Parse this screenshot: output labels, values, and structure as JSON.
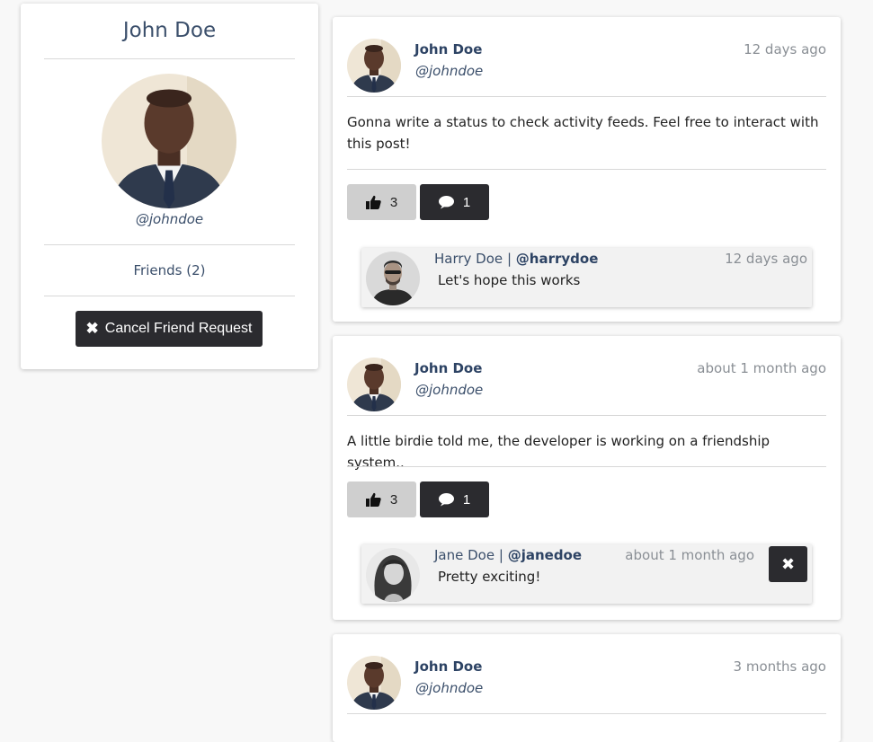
{
  "profile": {
    "name": "John Doe",
    "handle": "@johndoe",
    "friends_label": "Friends (2)",
    "cancel_request_label": "Cancel Friend Request"
  },
  "posts": [
    {
      "author": "John Doe",
      "handle": "@johndoe",
      "time": "12 days ago",
      "body": "Gonna write a status to check activity feeds. Feel free to interact with this post!",
      "likes": "3",
      "comments": "1",
      "comment": {
        "name": "Harry Doe",
        "separator": "|",
        "handle": "@harrydoe",
        "time": "12 days ago",
        "text": "Let's hope this works"
      }
    },
    {
      "author": "John Doe",
      "handle": "@johndoe",
      "time": "about 1 month ago",
      "body": "A little birdie told me, the developer is working on a friendship system..",
      "likes": "3",
      "comments": "1",
      "comment": {
        "name": "Jane Doe",
        "separator": "|",
        "handle": "@janedoe",
        "time": "about 1 month ago",
        "text": "Pretty exciting!"
      }
    },
    {
      "author": "John Doe",
      "handle": "@johndoe",
      "time": "3 months ago"
    }
  ],
  "icons": {
    "cancel": "times-icon",
    "like": "thumbs-up-icon",
    "comment": "speech-bubble-icon",
    "delete": "times-icon"
  },
  "colors": {
    "primary_text": "#2d4364",
    "dark_button": "#2b2b2f",
    "like_button": "#cfcfcf",
    "muted": "#8a8f95"
  }
}
